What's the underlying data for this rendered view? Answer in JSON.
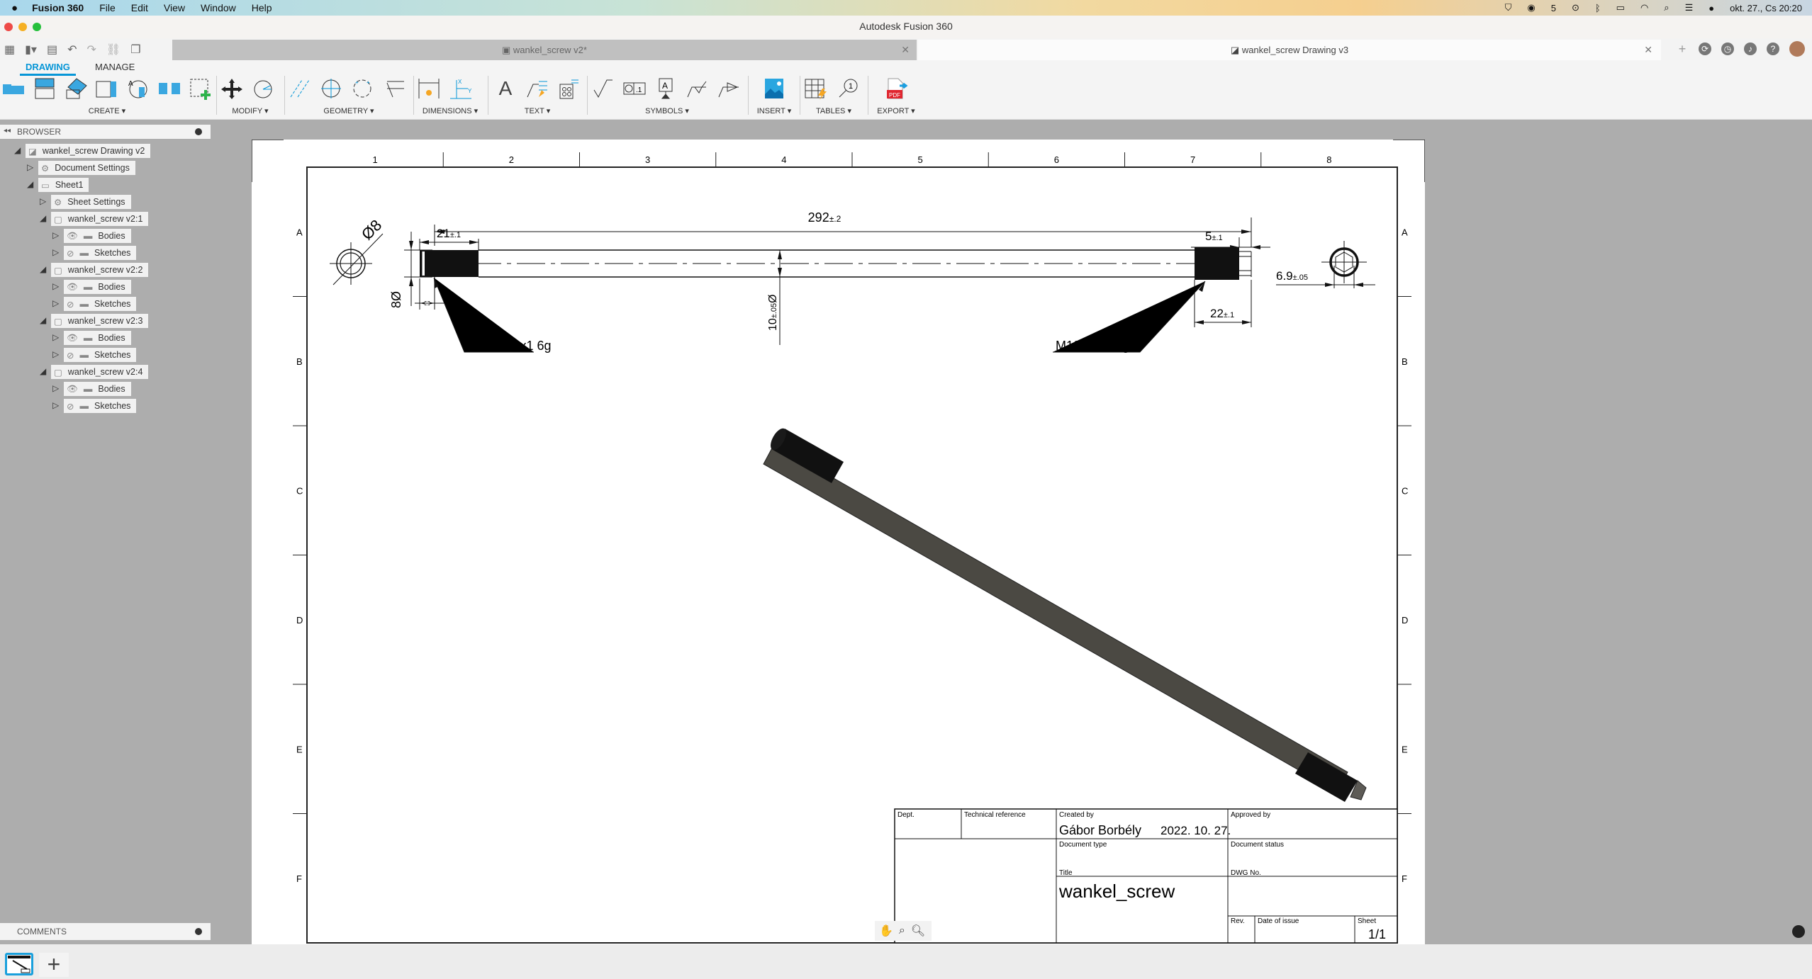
{
  "menubar": {
    "app": "Fusion 360",
    "items": [
      "File",
      "Edit",
      "View",
      "Window",
      "Help"
    ],
    "datetime": "okt. 27., Cs  20:20"
  },
  "window": {
    "title": "Autodesk Fusion 360"
  },
  "tabs": [
    {
      "label": "wankel_screw v2*",
      "active": false
    },
    {
      "label": "wankel_screw Drawing v3",
      "active": true
    }
  ],
  "quick_toolbar": [
    "grid-menu-icon",
    "file-icon",
    "save-icon",
    "undo-icon",
    "redo-icon",
    "link-icon",
    "copy-icon"
  ],
  "ribbon": {
    "tabs": [
      {
        "label": "DRAWING",
        "active": true
      },
      {
        "label": "MANAGE",
        "active": false
      }
    ],
    "groups": [
      {
        "label": "CREATE",
        "tools": [
          "base-view",
          "projected-view",
          "section-view",
          "detail-view",
          "break-view",
          "auxiliary-view",
          "sketch"
        ]
      },
      {
        "label": "MODIFY",
        "tools": [
          "move",
          "rotate"
        ]
      },
      {
        "label": "GEOMETRY",
        "tools": [
          "centerline",
          "center-mark",
          "center-mark-pattern",
          "edge-extension"
        ]
      },
      {
        "label": "DIMENSIONS",
        "tools": [
          "dimension",
          "ordinate-dimension"
        ]
      },
      {
        "label": "TEXT",
        "tools": [
          "text",
          "leader",
          "note"
        ]
      },
      {
        "label": "SYMBOLS",
        "tools": [
          "surface-texture",
          "feature-control-frame",
          "datum",
          "welding",
          "taper"
        ]
      },
      {
        "label": "INSERT",
        "tools": [
          "insert-image"
        ]
      },
      {
        "label": "TABLES",
        "tools": [
          "table",
          "balloon"
        ]
      },
      {
        "label": "EXPORT",
        "tools": [
          "pdf"
        ]
      }
    ],
    "accent": "#0696d7"
  },
  "browser": {
    "title": "BROWSER",
    "nodes": [
      {
        "label": "wankel_screw Drawing v2",
        "level": 0,
        "icon": "drawing",
        "expanded": true
      },
      {
        "label": "Document Settings",
        "level": 1,
        "icon": "gear",
        "expanded": false
      },
      {
        "label": "Sheet1",
        "level": 1,
        "icon": "sheet",
        "expanded": true
      },
      {
        "label": "Sheet Settings",
        "level": 2,
        "icon": "gear",
        "expanded": false
      },
      {
        "label": "wankel_screw v2:1",
        "level": 2,
        "icon": "component",
        "expanded": true
      },
      {
        "label": "Bodies",
        "level": 3,
        "icon": "folder",
        "visible": true,
        "expanded": false
      },
      {
        "label": "Sketches",
        "level": 3,
        "icon": "folder",
        "visible": false,
        "expanded": false
      },
      {
        "label": "wankel_screw v2:2",
        "level": 2,
        "icon": "component",
        "expanded": true
      },
      {
        "label": "Bodies",
        "level": 3,
        "icon": "folder",
        "visible": true,
        "expanded": false
      },
      {
        "label": "Sketches",
        "level": 3,
        "icon": "folder",
        "visible": false,
        "expanded": false
      },
      {
        "label": "wankel_screw v2:3",
        "level": 2,
        "icon": "component",
        "expanded": true
      },
      {
        "label": "Bodies",
        "level": 3,
        "icon": "folder",
        "visible": true,
        "expanded": false
      },
      {
        "label": "Sketches",
        "level": 3,
        "icon": "folder",
        "visible": false,
        "expanded": false
      },
      {
        "label": "wankel_screw v2:4",
        "level": 2,
        "icon": "component",
        "expanded": true
      },
      {
        "label": "Bodies",
        "level": 3,
        "icon": "folder",
        "visible": true,
        "expanded": false
      },
      {
        "label": "Sketches",
        "level": 3,
        "icon": "folder",
        "visible": false,
        "expanded": false
      }
    ]
  },
  "comments": {
    "title": "COMMENTS"
  },
  "drawing": {
    "zone_columns": [
      "1",
      "2",
      "3",
      "4",
      "5",
      "6",
      "7",
      "8"
    ],
    "zone_rows": [
      "A",
      "B",
      "C",
      "D",
      "E",
      "F"
    ],
    "dimensions": {
      "overall_length": "292",
      "overall_length_tol": "±.2",
      "left_thread_length": "21",
      "left_thread_tol": "±.1",
      "chamfer": "2",
      "left_end_dia": "8Ø",
      "end_view_dia": "Ø8",
      "shaft_dia": "10",
      "shaft_dia_tol": "±.05",
      "shaft_dia_suffix": "Ø",
      "right_gap": "5",
      "right_gap_tol": "±.1",
      "right_thread_length": "22",
      "right_thread_tol": "±.1",
      "hex_size": "6.9",
      "hex_tol": "±.05"
    },
    "callouts": {
      "left_thread": "M10x1 6g",
      "right_thread": "M10x1.25 6g"
    },
    "title_block": {
      "dept_label": "Dept.",
      "tech_ref_label": "Technical reference",
      "created_by_label": "Created by",
      "created_by": "Gábor Borbély",
      "created_date": "2022. 10. 27.",
      "approved_by_label": "Approved by",
      "doc_type_label": "Document type",
      "doc_status_label": "Document status",
      "title_label": "Title",
      "title": "wankel_screw",
      "dwg_no_label": "DWG No.",
      "rev_label": "Rev.",
      "date_issue_label": "Date of issue",
      "sheet_label": "Sheet",
      "sheet": "1/1"
    }
  },
  "nav_tools": [
    "pan-icon",
    "zoom-window-icon",
    "zoom-icon"
  ]
}
